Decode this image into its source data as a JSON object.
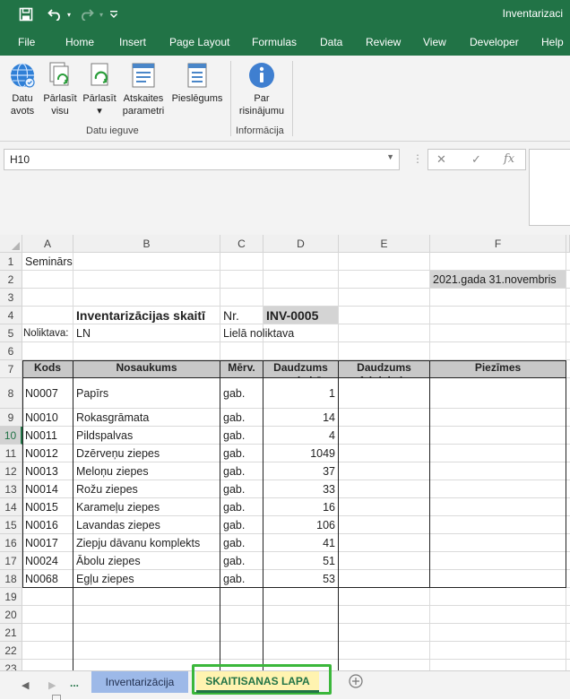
{
  "titlebar": {
    "document_title": "Inventarizaci",
    "save_icon": "save-icon",
    "undo_icon": "undo-icon",
    "redo_icon": "redo-icon",
    "customize_icon": "chevron-down-icon"
  },
  "menu": [
    "File",
    "Home",
    "Insert",
    "Page Layout",
    "Formulas",
    "Data",
    "Review",
    "View",
    "Developer",
    "Help"
  ],
  "ribbon": {
    "buttons": [
      {
        "name": "datu-avots-button",
        "label": "Datu\navots",
        "icon": "globe-icon"
      },
      {
        "name": "parlasit-visu-button",
        "label": "Pārlasīt\nvisu",
        "icon": "refresh-all-icon"
      },
      {
        "name": "parlasit-button",
        "label": "Pārlasīt\n▾",
        "icon": "refresh-icon"
      },
      {
        "name": "atskaites-parametri-button",
        "label": "Atskaites\nparametri",
        "icon": "report-icon"
      },
      {
        "name": "pieslegums-button",
        "label": "Pieslēgums",
        "icon": "connection-icon"
      },
      {
        "name": "par-risinajumu-button",
        "label": "Par\nrisinājumu",
        "icon": "info-icon"
      }
    ],
    "groups": [
      "Datu ieguve",
      "Informācija"
    ]
  },
  "formula_bar": {
    "name_box": "H10",
    "cancel": "✕",
    "enter": "✓",
    "fx": "fx",
    "formula": ""
  },
  "columns": [
    "A",
    "B",
    "C",
    "D",
    "E",
    "F"
  ],
  "rows": [
    "1",
    "2",
    "3",
    "4",
    "5",
    "6",
    "7",
    "8",
    "9",
    "10",
    "11",
    "12",
    "13",
    "14",
    "15",
    "16",
    "17",
    "18",
    "19",
    "20",
    "21",
    "22",
    "23"
  ],
  "sheet": {
    "a1": "Seminārs",
    "date": "2021.gada 31.novembris",
    "title": "Inventarizācijas skaitī",
    "nr_label": "Nr.",
    "inv_no": "INV-0005",
    "warehouse_label": "Noliktava:",
    "warehouse_code": "LN",
    "warehouse_name": "Lielā noliktava",
    "headers": {
      "kods": "Kods",
      "nosaukums": "Nosaukums",
      "merv": "Mērv.",
      "daudzums_uzskaite": "Daudzums\nuzskaitē",
      "daudzums_faktiskais": "Daudzums\nfaktiskais",
      "piezimes": "Piezīmes"
    },
    "items": [
      {
        "kods": "N0007",
        "nosaukums": "Papīrs",
        "merv": "gab.",
        "qty": "1"
      },
      {
        "kods": "N0010",
        "nosaukums": "Rokasgrāmata",
        "merv": "gab.",
        "qty": "14"
      },
      {
        "kods": "N0011",
        "nosaukums": "Pildspalvas",
        "merv": "gab.",
        "qty": "4"
      },
      {
        "kods": "N0012",
        "nosaukums": "Dzērveņu ziepes",
        "merv": "gab.",
        "qty": "1049"
      },
      {
        "kods": "N0013",
        "nosaukums": "Meloņu ziepes",
        "merv": "gab.",
        "qty": "37"
      },
      {
        "kods": "N0014",
        "nosaukums": "Rožu ziepes",
        "merv": "gab.",
        "qty": "33"
      },
      {
        "kods": "N0015",
        "nosaukums": "Karameļu ziepes",
        "merv": "gab.",
        "qty": "16"
      },
      {
        "kods": "N0016",
        "nosaukums": "Lavandas ziepes",
        "merv": "gab.",
        "qty": "106"
      },
      {
        "kods": "N0017",
        "nosaukums": "Ziepju dāvanu komplekts",
        "merv": "gab.",
        "qty": "41"
      },
      {
        "kods": "N0024",
        "nosaukums": "Ābolu ziepes",
        "merv": "gab.",
        "qty": "51"
      },
      {
        "kods": "N0068",
        "nosaukums": "Egļu ziepes",
        "merv": "gab.",
        "qty": "53"
      }
    ]
  },
  "sheet_tabs": {
    "ellipsis": "...",
    "tabs": [
      "Inventarizācija",
      "SKAITISANAS LAPA"
    ],
    "active": 1,
    "add_icon": "plus-circle-icon"
  },
  "colors": {
    "excel_green": "#217346",
    "active_row_header": "#217346",
    "highlight_green": "#3bb73b",
    "header_gray": "#c8c8c8",
    "tab_blue": "#9db9e8",
    "active_tab_yellow": "#fff3b0"
  }
}
